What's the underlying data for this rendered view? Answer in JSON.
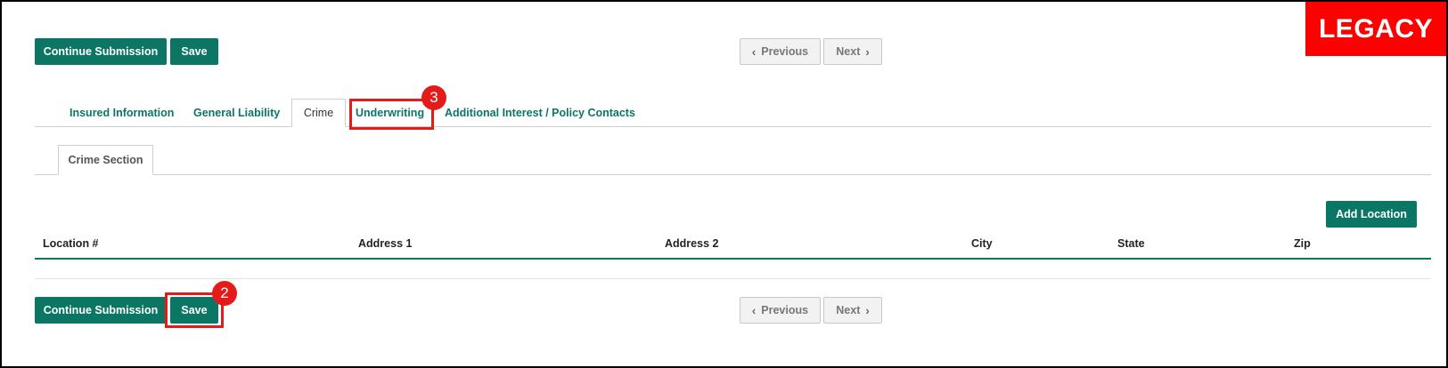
{
  "watermark": {
    "label": "LEGACY"
  },
  "top_actions": {
    "continue_label": "Continue Submission",
    "save_label": "Save",
    "previous_label": "Previous",
    "next_label": "Next"
  },
  "tabs": [
    {
      "label": "Insured Information"
    },
    {
      "label": "General Liability"
    },
    {
      "label": "Crime",
      "active": true
    },
    {
      "label": "Underwriting"
    },
    {
      "label": "Additional Interest / Policy Contacts"
    }
  ],
  "subtabs": [
    {
      "label": "Crime Section",
      "active": true
    }
  ],
  "add_location_label": "Add Location",
  "table": {
    "columns": [
      "Location #",
      "Address 1",
      "Address 2",
      "City",
      "State",
      "Zip"
    ],
    "rows": []
  },
  "bottom_actions": {
    "continue_label": "Continue Submission",
    "save_label": "Save",
    "previous_label": "Previous",
    "next_label": "Next"
  },
  "annotations": [
    {
      "number": "3",
      "target": "Underwriting tab"
    },
    {
      "number": "2",
      "target": "bottom Save button"
    }
  ],
  "colors": {
    "brand_green": "#0b7664",
    "annotation_red": "#e41b1b",
    "legacy_red": "#ff0000"
  },
  "icons": {
    "previous": "chevron-left-icon",
    "next": "chevron-right-icon"
  }
}
